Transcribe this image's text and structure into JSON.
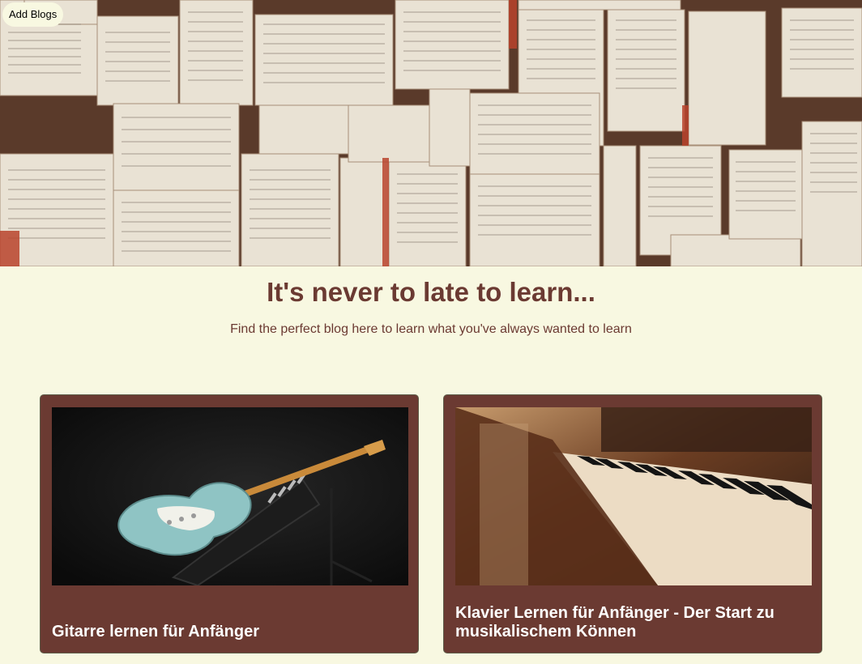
{
  "header": {
    "add_blogs_label": "Add Blogs",
    "hero_image": "open-books-wall"
  },
  "intro": {
    "title": "It's never to late to learn...",
    "subtitle": "Find the perfect blog here to learn what you've always wanted to learn"
  },
  "blogs": [
    {
      "title": "Gitarre lernen für Anfänger",
      "image": "electric-guitar"
    },
    {
      "title": "Klavier Lernen für Anfänger - Der Start zu musikalischem Können",
      "image": "piano-keys"
    }
  ],
  "colors": {
    "background": "#f8f8e1",
    "accent": "#6b3a32",
    "card_text": "#ffffff"
  }
}
